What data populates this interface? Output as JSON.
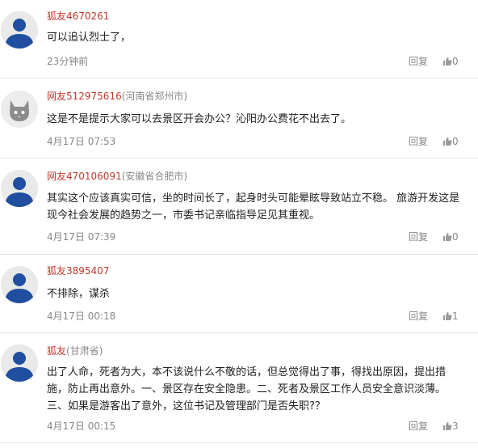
{
  "colors": {
    "username": "#c0392b",
    "meta": "#888888",
    "divider": "#e5e5e5",
    "avatar_blue": "#1f4f9e"
  },
  "comments": [
    {
      "avatar": "blue-figure-icon",
      "user": "狐友4670261",
      "location": "",
      "lines": [
        "可以追认烈士了，"
      ],
      "time": "23分钟前",
      "reply_label": "回复",
      "likes": "0"
    },
    {
      "avatar": "gray-cat-icon",
      "user": "网友512975616",
      "location": "(河南省郑州市)",
      "lines": [
        "这是不是提示大家可以去景区开会办公？沁阳办公费花不出去了。"
      ],
      "time": "4月17日 07:53",
      "reply_label": "回复",
      "likes": "0"
    },
    {
      "avatar": "blue-figure-icon",
      "user": "网友470106091",
      "location": "(安徽省合肥市)",
      "lines": [
        "其实这个应该真实可信，坐的时间长了，起身时头可能晕眩导致站立不稳。 旅游开发这是",
        "现今社会发展的趋势之一，市委书记亲临指导足见其重视。"
      ],
      "time": "4月17日 07:39",
      "reply_label": "回复",
      "likes": "0"
    },
    {
      "avatar": "blue-figure-icon",
      "user": "狐友3895407",
      "location": "",
      "lines": [
        "不排除，谋杀"
      ],
      "time": "4月17日 00:18",
      "reply_label": "回复",
      "likes": "1"
    },
    {
      "avatar": "blue-figure-icon",
      "user": "狐友",
      "location": "(甘肃省)",
      "lines": [
        "出了人命，死者为大，本不该说什么不敬的话，但总觉得出了事，得找出原因，提出措",
        "施，防止再出意外。一、景区存在安全隐患。二、死者及景区工作人员安全意识淡薄。",
        "三、如果是游客出了意外，这位书记及管理部门是否失职?？"
      ],
      "time": "4月17日 00:15",
      "reply_label": "回复",
      "likes": "3"
    }
  ]
}
